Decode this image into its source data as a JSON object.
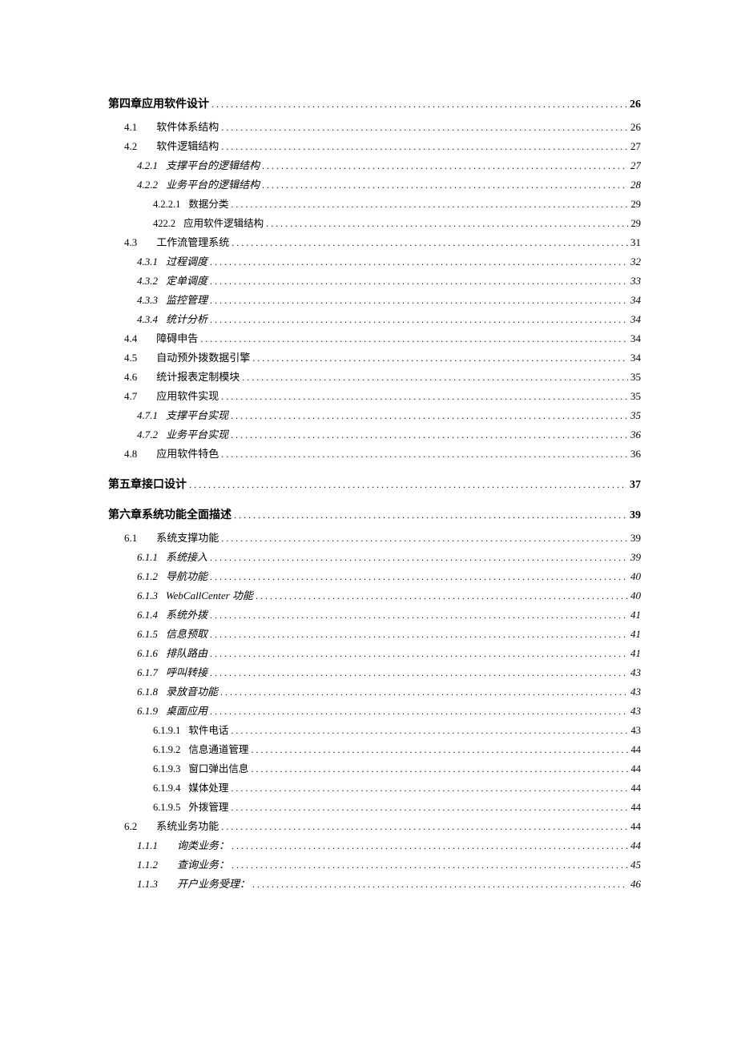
{
  "toc": [
    {
      "level": 0,
      "num": "第四章",
      "text": "应用软件设计",
      "page": "26",
      "gapBefore": false
    },
    {
      "level": 1,
      "num": "4.1",
      "text": "软件体系结构",
      "page": "26"
    },
    {
      "level": 1,
      "num": "4.2",
      "text": "软件逻辑结构",
      "page": "27"
    },
    {
      "level": 2,
      "num": "4.2.1",
      "text": "支撑平台的逻辑结构",
      "page": "27"
    },
    {
      "level": 2,
      "num": "4.2.2",
      "text": "业务平台的逻辑结构",
      "page": "28"
    },
    {
      "level": 3,
      "num": "4.2.2.1",
      "text": "数据分类",
      "page": "29"
    },
    {
      "level": 3,
      "num": "422.2",
      "text": "应用软件逻辑结构",
      "page": "29"
    },
    {
      "level": 1,
      "num": "4.3",
      "text": "工作流管理系统",
      "page": "31"
    },
    {
      "level": 2,
      "num": "4.3.1",
      "text": "过程调度",
      "page": "32"
    },
    {
      "level": 2,
      "num": "4.3.2",
      "text": "定单调度",
      "page": "33"
    },
    {
      "level": 2,
      "num": "4.3.3",
      "text": "监控管理",
      "page": "34"
    },
    {
      "level": 2,
      "num": "4.3.4",
      "text": "统计分析",
      "page": "34"
    },
    {
      "level": 1,
      "num": "4.4",
      "text": "障碍申告",
      "page": "34"
    },
    {
      "level": 1,
      "num": "4.5",
      "text": "自动预外拨数据引擎",
      "page": "34"
    },
    {
      "level": 1,
      "num": "4.6",
      "text": "统计报表定制模块",
      "page": "35"
    },
    {
      "level": 1,
      "num": "4.7",
      "text": "应用软件实现",
      "page": "35"
    },
    {
      "level": 2,
      "num": "4.7.1",
      "text": "支撑平台实现",
      "page": "35"
    },
    {
      "level": 2,
      "num": "4.7.2",
      "text": "业务平台实现",
      "page": "36"
    },
    {
      "level": 1,
      "num": "4.8",
      "text": "应用软件特色",
      "page": "36"
    },
    {
      "level": 0,
      "num": "第五章",
      "text": "接口设计",
      "page": "37",
      "gapBefore": true
    },
    {
      "level": 0,
      "num": "第六章",
      "text": "系统功能全面描述",
      "page": "39",
      "gapBefore": true
    },
    {
      "level": 1,
      "num": "6.1",
      "text": "系统支撑功能",
      "page": "39"
    },
    {
      "level": 2,
      "num": "6.1.1",
      "text": "系统接入",
      "page": "39"
    },
    {
      "level": 2,
      "num": "6.1.2",
      "text": "导航功能",
      "page": "40"
    },
    {
      "level": 2,
      "num": "6.1.3",
      "text": "WebCallCenter 功能",
      "page": "40"
    },
    {
      "level": 2,
      "num": "6.1.4",
      "text": "系统外拨",
      "page": "41"
    },
    {
      "level": 2,
      "num": "6.1.5",
      "text": "信息预取",
      "page": "41"
    },
    {
      "level": 2,
      "num": "6.1.6",
      "text": "排队路由",
      "page": "41"
    },
    {
      "level": 2,
      "num": "6.1.7",
      "text": "呼叫转接",
      "page": "43"
    },
    {
      "level": 2,
      "num": "6.1.8",
      "text": "录放音功能",
      "page": "43"
    },
    {
      "level": 2,
      "num": "6.1.9",
      "text": "桌面应用",
      "page": "43"
    },
    {
      "level": 3,
      "num": "6.1.9.1",
      "text": "软件电话",
      "page": "43"
    },
    {
      "level": 3,
      "num": "6.1.9.2",
      "text": "信息通道管理",
      "page": "44"
    },
    {
      "level": 3,
      "num": "6.1.9.3",
      "text": "窗口弹出信息",
      "page": "44"
    },
    {
      "level": 3,
      "num": "6.1.9.4",
      "text": "媒体处理",
      "page": "44"
    },
    {
      "level": 3,
      "num": "6.1.9.5",
      "text": "外拨管理",
      "page": "44"
    },
    {
      "level": 1,
      "num": "6.2",
      "text": "系统业务功能",
      "page": "44"
    },
    {
      "level": 2,
      "num": "1.1.1",
      "text": "询类业务：",
      "page": "44",
      "wideGap": true
    },
    {
      "level": 2,
      "num": "1.1.2",
      "text": "查询业务：",
      "page": "45",
      "wideGap": true
    },
    {
      "level": 2,
      "num": "1.1.3",
      "text": "开户业务受理：",
      "page": "46",
      "wideGap": true
    }
  ]
}
